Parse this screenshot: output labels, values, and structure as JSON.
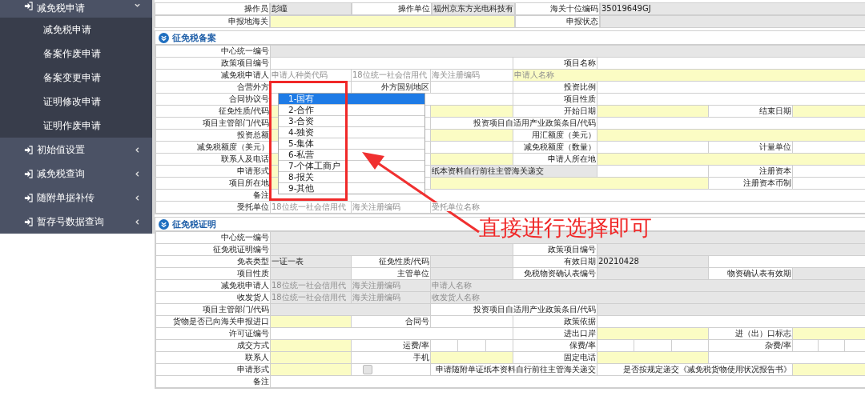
{
  "sidebar": {
    "items": [
      {
        "label": "减免税申请",
        "expanded": true,
        "children": [
          {
            "label": "减免税申请"
          },
          {
            "label": "备案作废申请"
          },
          {
            "label": "备案变更申请"
          },
          {
            "label": "证明修改申请"
          },
          {
            "label": "证明作废申请"
          }
        ]
      },
      {
        "label": "初始值设置",
        "expanded": false
      },
      {
        "label": "减免税查询",
        "expanded": false
      },
      {
        "label": "随附单据补传",
        "expanded": false
      },
      {
        "label": "暂存号数据查询",
        "expanded": false
      }
    ]
  },
  "header_form": {
    "rows": [
      {
        "cells": [
          {
            "kind": "label",
            "text": "操作员"
          },
          {
            "kind": "readonly",
            "value": "彭瞳"
          },
          {
            "kind": "label",
            "text": "操作单位"
          },
          {
            "kind": "readonly",
            "value": "福州京东方光电科技有"
          },
          {
            "kind": "label",
            "text": "海关十位编码"
          },
          {
            "kind": "readonly",
            "value": "35019649GJ",
            "colspan": 3
          }
        ]
      },
      {
        "cells": [
          {
            "kind": "label",
            "text": "申报地海关"
          },
          {
            "kind": "required",
            "colspan": 3
          },
          {
            "kind": "label",
            "text": "申报状态"
          },
          {
            "kind": "readonly",
            "colspan": 3
          }
        ]
      }
    ]
  },
  "filing_section": {
    "title": "征免税备案",
    "rows": [
      {
        "cells": [
          {
            "kind": "label",
            "text": "中心统一编号"
          },
          {
            "kind": "readonly",
            "colspan": 7
          }
        ]
      },
      {
        "cells": [
          {
            "kind": "label",
            "text": "政策项目编号"
          },
          {
            "kind": "optional",
            "colspan": 3
          },
          {
            "kind": "label",
            "text": "项目名称"
          },
          {
            "kind": "optional",
            "colspan": 3
          }
        ]
      },
      {
        "cells": [
          {
            "kind": "label",
            "text": "减免税申请人"
          },
          {
            "kind": "optional",
            "placeholder": "申请人种类代码"
          },
          {
            "kind": "optional",
            "placeholder": "18位统一社会信用代"
          },
          {
            "kind": "optional",
            "placeholder": "海关注册编码"
          },
          {
            "kind": "required",
            "placeholder": "申请人名称",
            "colspan": 4
          }
        ]
      },
      {
        "cells": [
          {
            "kind": "label",
            "text": "合营外方"
          },
          {
            "kind": "optional"
          },
          {
            "kind": "label",
            "text": "外方国别地区"
          },
          {
            "kind": "optional"
          },
          {
            "kind": "label",
            "text": "投资比例"
          },
          {
            "kind": "optional",
            "colspan": 3
          }
        ]
      },
      {
        "cells": [
          {
            "kind": "label",
            "text": "合同协议号"
          },
          {
            "kind": "optional",
            "colspan": 3
          },
          {
            "kind": "label",
            "text": "项目性质"
          },
          {
            "kind": "optional",
            "colspan": 3
          }
        ]
      },
      {
        "cells": [
          {
            "kind": "label",
            "text": "征免性质/代码"
          },
          {
            "kind": "required"
          },
          {
            "kind": "optional"
          },
          {
            "kind": "required"
          },
          {
            "kind": "label",
            "text": "开始日期"
          },
          {
            "kind": "required"
          },
          {
            "kind": "label",
            "text": "结束日期"
          },
          {
            "kind": "required"
          }
        ]
      },
      {
        "cells": [
          {
            "kind": "label",
            "text": "项目主管部门/代码"
          },
          {
            "kind": "required"
          },
          {
            "kind": "optional"
          },
          {
            "kind": "label",
            "text": "投资项目自适用产业政策条目/代码",
            "colspan": 2
          },
          {
            "kind": "optional",
            "colspan": 3
          }
        ]
      },
      {
        "cells": [
          {
            "kind": "label",
            "text": "投资总额"
          },
          {
            "kind": "required"
          },
          {
            "kind": "optional"
          },
          {
            "kind": "required"
          },
          {
            "kind": "label",
            "text": "用汇额度（美元）"
          },
          {
            "kind": "required",
            "colspan": 3
          }
        ]
      },
      {
        "cells": [
          {
            "kind": "label",
            "text": "减免税额度（美元）"
          },
          {
            "kind": "optional"
          },
          {
            "kind": "optional"
          },
          {
            "kind": "optional"
          },
          {
            "kind": "label",
            "text": "减免税额度（数量）"
          },
          {
            "kind": "optional"
          },
          {
            "kind": "label",
            "text": "计量单位"
          },
          {
            "kind": "optional"
          }
        ]
      },
      {
        "cells": [
          {
            "kind": "label",
            "text": "联系人及电话"
          },
          {
            "kind": "required"
          },
          {
            "kind": "optional"
          },
          {
            "kind": "required"
          },
          {
            "kind": "label",
            "text": "申请人所在地"
          },
          {
            "kind": "required",
            "colspan": 3
          }
        ]
      },
      {
        "cells": [
          {
            "kind": "label",
            "text": "申请形式"
          },
          {
            "kind": "required"
          },
          {
            "kind": "optional"
          },
          {
            "kind": "readonly",
            "value": "纸本资料自行前往主管海关递交",
            "colspan": 2
          },
          {
            "kind": "optional"
          },
          {
            "kind": "label",
            "text": "注册资本"
          },
          {
            "kind": "optional"
          }
        ]
      },
      {
        "cells": [
          {
            "kind": "label",
            "text": "项目所在地"
          },
          {
            "kind": "required"
          },
          {
            "kind": "optional"
          },
          {
            "kind": "required",
            "colspan": 3
          },
          {
            "kind": "label",
            "text": "注册资本币制"
          },
          {
            "kind": "optional"
          }
        ]
      },
      {
        "cells": [
          {
            "kind": "label",
            "text": "备注"
          },
          {
            "kind": "optional",
            "colspan": 7
          }
        ]
      },
      {
        "cells": [
          {
            "kind": "label",
            "text": "受托单位"
          },
          {
            "kind": "optional",
            "placeholder": "18位统一社会信用代"
          },
          {
            "kind": "optional",
            "placeholder": "海关注册编码"
          },
          {
            "kind": "optional",
            "placeholder": "受托单位名称",
            "colspan": 5
          }
        ]
      }
    ]
  },
  "certificate_section": {
    "title": "征免税证明",
    "rows": [
      {
        "cells": [
          {
            "kind": "label",
            "text": "中心统一编号"
          },
          {
            "kind": "readonly",
            "colspan": 7
          }
        ]
      },
      {
        "cells": [
          {
            "kind": "label",
            "text": "征免税证明编号"
          },
          {
            "kind": "readonly",
            "colspan": 3
          },
          {
            "kind": "label",
            "text": "政策项目编号"
          },
          {
            "kind": "readonly",
            "colspan": 3
          }
        ]
      },
      {
        "cells": [
          {
            "kind": "label",
            "text": "免表类型"
          },
          {
            "kind": "readonly",
            "value": "一证一表"
          },
          {
            "kind": "label",
            "text": "征免性质/代码"
          },
          {
            "kind": "readonly"
          },
          {
            "kind": "label",
            "text": "有效日期"
          },
          {
            "kind": "readonly",
            "value": "20210428"
          },
          {
            "kind": "optional",
            "colspan": 2
          }
        ]
      },
      {
        "cells": [
          {
            "kind": "label",
            "text": "项目性质"
          },
          {
            "kind": "readonly"
          },
          {
            "kind": "label",
            "text": "主管单位"
          },
          {
            "kind": "readonly"
          },
          {
            "kind": "label",
            "text": "免税物资确认表编号"
          },
          {
            "kind": "readonly"
          },
          {
            "kind": "label",
            "text": "物资确认表有效期"
          },
          {
            "kind": "readonly"
          }
        ]
      },
      {
        "cells": [
          {
            "kind": "label",
            "text": "减免税申请人"
          },
          {
            "kind": "readonly",
            "placeholder": "18位统一社会信用代"
          },
          {
            "kind": "readonly",
            "placeholder": "海关注册编码"
          },
          {
            "kind": "readonly",
            "placeholder": "申请人名称",
            "colspan": 5
          }
        ]
      },
      {
        "cells": [
          {
            "kind": "label",
            "text": "收发货人"
          },
          {
            "kind": "readonly",
            "placeholder": "18位统一社会信用代"
          },
          {
            "kind": "readonly",
            "placeholder": "海关注册编码"
          },
          {
            "kind": "readonly",
            "placeholder": "收发货人名称",
            "colspan": 5
          }
        ]
      },
      {
        "cells": [
          {
            "kind": "label",
            "text": "项目主管部门/代码"
          },
          {
            "kind": "readonly",
            "colspan": 2
          },
          {
            "kind": "label",
            "text": "投资项目自适用产业政策条目/代码",
            "colspan": 2
          },
          {
            "kind": "readonly",
            "colspan": 3
          }
        ]
      },
      {
        "cells": [
          {
            "kind": "label",
            "text": "货物是否已向海关申报进口"
          },
          {
            "kind": "required"
          },
          {
            "kind": "label",
            "text": "合同号"
          },
          {
            "kind": "optional"
          },
          {
            "kind": "label",
            "text": "政策依据"
          },
          {
            "kind": "optional",
            "colspan": 3
          }
        ]
      },
      {
        "cells": [
          {
            "kind": "label",
            "text": "许可证编号"
          },
          {
            "kind": "optional",
            "colspan": 3
          },
          {
            "kind": "label",
            "text": "进出口岸"
          },
          {
            "kind": "required"
          },
          {
            "kind": "label",
            "text": "进（出）口标志"
          },
          {
            "kind": "required"
          }
        ]
      },
      {
        "cells": [
          {
            "kind": "label",
            "text": "成交方式"
          },
          {
            "kind": "required"
          },
          {
            "kind": "label",
            "text": "运费/率"
          },
          {
            "kind": "triple"
          },
          {
            "kind": "label",
            "text": "保费/率"
          },
          {
            "kind": "triple"
          },
          {
            "kind": "label",
            "text": "杂费/率"
          },
          {
            "kind": "triple"
          }
        ]
      },
      {
        "cells": [
          {
            "kind": "label",
            "text": "联系人"
          },
          {
            "kind": "required"
          },
          {
            "kind": "label",
            "text": "手机"
          },
          {
            "kind": "required"
          },
          {
            "kind": "label",
            "text": "固定电话"
          },
          {
            "kind": "required"
          },
          {
            "kind": "optional",
            "colspan": 2
          }
        ]
      },
      {
        "cells": [
          {
            "kind": "label",
            "text": "申请形式"
          },
          {
            "kind": "required"
          },
          {
            "kind": "checkbox",
            "checked": false
          },
          {
            "kind": "label",
            "text": "申请随附单证纸本资料自行前往主管海关递交",
            "colspan": 2
          },
          {
            "kind": "label",
            "text": "是否按规定递交《减免税货物使用状况报告书》",
            "colspan": 2
          },
          {
            "kind": "required"
          }
        ]
      },
      {
        "cells": [
          {
            "kind": "label",
            "text": "备注"
          },
          {
            "kind": "optional",
            "colspan": 7
          }
        ]
      }
    ]
  },
  "dropdown": {
    "options": [
      {
        "label": "1-国有",
        "selected": true
      },
      {
        "label": "2-合作",
        "selected": false
      },
      {
        "label": "3-合资",
        "selected": false
      },
      {
        "label": "4-独资",
        "selected": false
      },
      {
        "label": "5-集体",
        "selected": false
      },
      {
        "label": "6-私营",
        "selected": false
      },
      {
        "label": "7-个体工商户",
        "selected": false
      },
      {
        "label": "8-报关",
        "selected": false
      },
      {
        "label": "9-其他",
        "selected": false
      }
    ]
  },
  "annotation": {
    "text": "直接进行选择即可"
  }
}
